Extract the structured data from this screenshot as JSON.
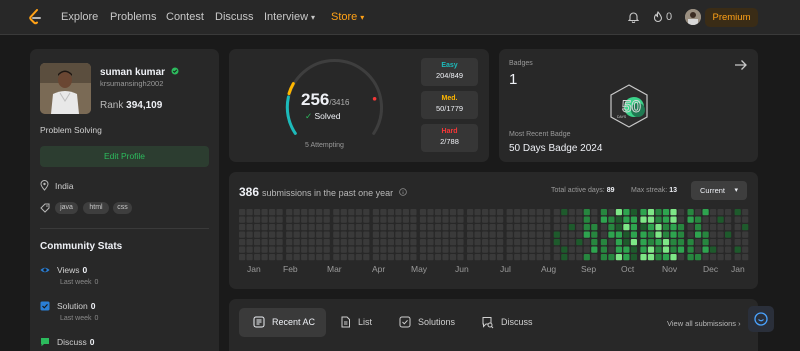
{
  "nav": {
    "items": [
      "Explore",
      "Problems",
      "Contest",
      "Discuss",
      "Interview"
    ],
    "store": "Store",
    "fire_count": "0",
    "premium": "Premium"
  },
  "profile": {
    "name": "suman kumar",
    "username": "krsumansingh2002",
    "rank_label": "Rank",
    "rank": "394,109",
    "problem_solving": "Problem Solving",
    "edit_button": "Edit Profile",
    "location": "India",
    "skills": [
      "java",
      "html",
      "css"
    ]
  },
  "community": {
    "title": "Community Stats",
    "stats": [
      {
        "label": "Views",
        "value": "0",
        "sub_label": "Last week",
        "sub_value": "0",
        "icon": "eye-icon",
        "color": "#2a7fd6"
      },
      {
        "label": "Solution",
        "value": "0",
        "sub_label": "Last week",
        "sub_value": "0",
        "icon": "solution-check-icon",
        "color": "#2a7fd6"
      },
      {
        "label": "Discuss",
        "value": "0",
        "icon": "discuss-icon",
        "color": "#2cbb5d"
      }
    ]
  },
  "solved": {
    "solved": "256",
    "total": "/3416",
    "solved_label": "Solved",
    "attempting": "5 Attempting",
    "difficulties": [
      {
        "name": "Easy",
        "value": "204/849",
        "color": "#1cbaba"
      },
      {
        "name": "Med.",
        "value": "50/1779",
        "color": "#ffb700"
      },
      {
        "name": "Hard",
        "value": "2/788",
        "color": "#f63737"
      }
    ]
  },
  "badges": {
    "label": "Badges",
    "count": "1",
    "recent_label": "Most Recent Badge",
    "recent_name": "50 Days Badge 2024",
    "badge_number": "50",
    "badge_caption": "DAYS"
  },
  "heatmap": {
    "count": "386",
    "title_suffix": "submissions in the past one year",
    "active_days_label": "Total active days:",
    "active_days": "89",
    "max_streak_label": "Max streak:",
    "max_streak": "13",
    "range_select": "Current",
    "months": [
      "Jan",
      "Feb",
      "Mar",
      "Apr",
      "May",
      "Jun",
      "Jul",
      "Aug",
      "Sep",
      "Oct",
      "Nov",
      "Dec",
      "Jan"
    ],
    "levels": [
      "#3a3a3a",
      "#1e5a2c",
      "#27863f",
      "#2ea44f",
      "#7ee787"
    ]
  },
  "recent": {
    "tabs": [
      "Recent AC",
      "List",
      "Solutions",
      "Discuss"
    ],
    "view_all": "View all submissions"
  },
  "colors": {
    "accent": "#ffa116",
    "green": "#2cbb5d"
  }
}
